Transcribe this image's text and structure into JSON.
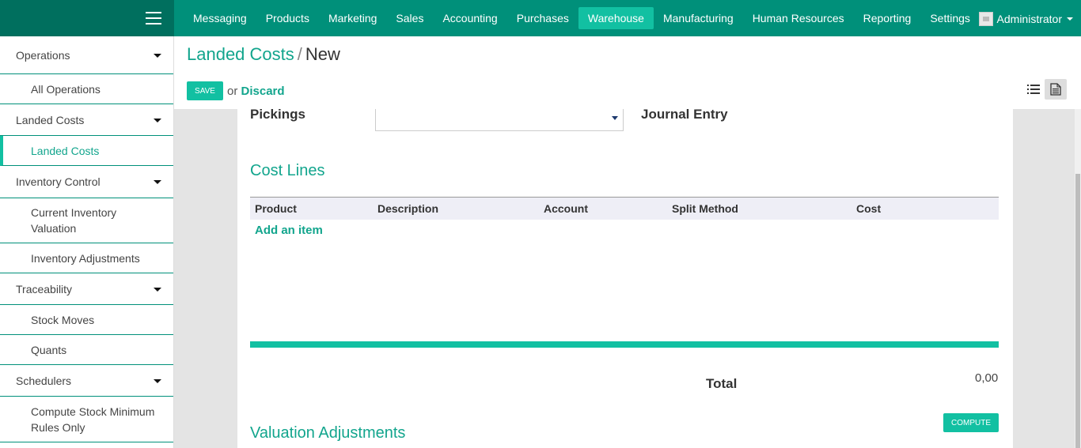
{
  "topbar": {
    "menu": [
      "Messaging",
      "Products",
      "Marketing",
      "Sales",
      "Accounting",
      "Purchases",
      "Warehouse",
      "Manufacturing",
      "Human Resources",
      "Reporting",
      "Settings"
    ],
    "active": "Warehouse",
    "user": "Administrator"
  },
  "sidebar": {
    "operations": "Operations",
    "all_operations": "All Operations",
    "landed_costs_section": "Landed Costs",
    "landed_costs": "Landed Costs",
    "inventory_control": "Inventory Control",
    "current_inventory_valuation": "Current Inventory Valuation",
    "inventory_adjustments": "Inventory Adjustments",
    "traceability": "Traceability",
    "stock_moves": "Stock Moves",
    "quants": "Quants",
    "schedulers": "Schedulers",
    "compute_stock_minimum": "Compute Stock Minimum Rules Only"
  },
  "breadcrumb": {
    "parent": "Landed Costs",
    "separator": "/",
    "current": "New"
  },
  "actions": {
    "save": "SAVE",
    "or": "or",
    "discard": "Discard"
  },
  "form": {
    "pickings_label": "Pickings",
    "pickings_value": "",
    "journal_entry_label": "Journal Entry",
    "cost_lines_title": "Cost Lines",
    "columns": {
      "product": "Product",
      "description": "Description",
      "account": "Account",
      "split_method": "Split Method",
      "cost": "Cost"
    },
    "add_item": "Add an item",
    "total_label": "Total",
    "total_value": "0,00",
    "compute": "COMPUTE",
    "valuation_title": "Valuation Adjustments"
  },
  "colors": {
    "primary": "#00907a",
    "accent": "#12c0a2",
    "text_link": "#12a58d"
  }
}
